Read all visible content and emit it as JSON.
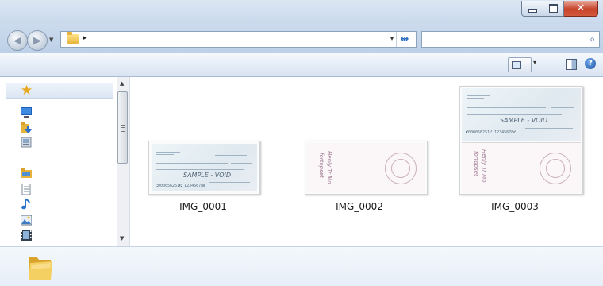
{
  "window": {
    "controls": {
      "minimize_icon": "minimize-icon",
      "maximize_icon": "maximize-icon",
      "close_glyph": "✕"
    }
  },
  "address_bar": {
    "location_icon": "folder-icon",
    "breadcrumb_arrow": "▸",
    "dropdown_glyph": "▾",
    "refresh_glyph": "↮"
  },
  "search": {
    "placeholder": "",
    "icon_glyph": "⌕"
  },
  "toolbar": {
    "view_dropdown_glyph": "▾",
    "help_glyph": "?"
  },
  "nav_pane": {
    "favorites_icon": "star-icon",
    "favorites_glyph": "★",
    "items": [
      {
        "icon": "desktop-icon"
      },
      {
        "icon": "downloads-icon"
      },
      {
        "icon": "recent-places-icon"
      },
      {
        "icon": "libraries-icon"
      },
      {
        "icon": "documents-icon"
      },
      {
        "icon": "music-icon"
      },
      {
        "icon": "pictures-icon"
      },
      {
        "icon": "videos-icon"
      }
    ]
  },
  "files": [
    {
      "name": "IMG_0001",
      "kind": "check-front"
    },
    {
      "name": "IMG_0002",
      "kind": "check-back"
    },
    {
      "name": "IMG_0003",
      "kind": "check-front-and-back"
    }
  ],
  "check_text": {
    "void_mark": "SAMPLE - VOID",
    "micr_line": "⑆000056251⑆ 12345678⑈"
  },
  "colors": {
    "accent": "#2d6fc2",
    "close_red": "#c7442a",
    "folder_yellow": "#e6b33c"
  }
}
